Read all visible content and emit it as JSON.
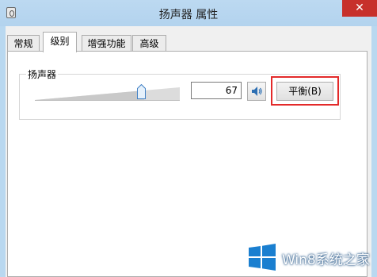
{
  "window": {
    "title": "扬声器 属性",
    "close_label": "✕",
    "app_icon": "speaker-device-icon"
  },
  "tabs": [
    {
      "label": "常规",
      "active": false
    },
    {
      "label": "级别",
      "active": true
    },
    {
      "label": "增强功能",
      "active": false
    },
    {
      "label": "高级",
      "active": false
    }
  ],
  "levels": {
    "group_label": "扬声器",
    "volume": 67,
    "volume_text": "67",
    "slider_fraction": 0.67,
    "mute_icon": "speaker-volume-icon",
    "balance_label": "平衡(B)",
    "highlight_color": "#e32a2a"
  },
  "watermark": {
    "text": "Win8系统之家",
    "logo_icon": "windows-logo-icon",
    "color": "#1a7fd0"
  }
}
